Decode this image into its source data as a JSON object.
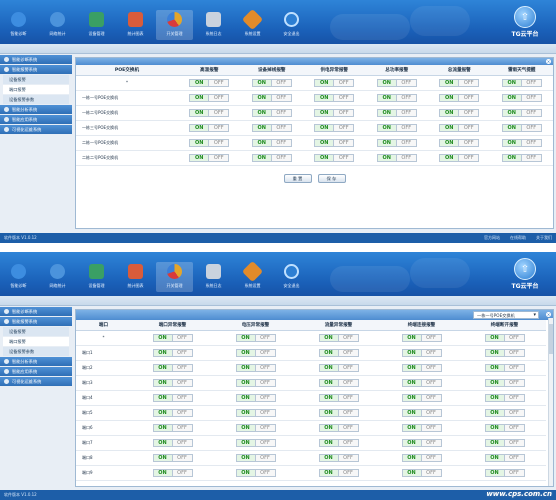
{
  "nav": {
    "items": [
      {
        "label": "智能诊断",
        "icon": "globe-icon",
        "color": "#3d8de0"
      },
      {
        "label": "网络统计",
        "icon": "globe-stats-icon",
        "color": "#4b93dc"
      },
      {
        "label": "设备管理",
        "icon": "device-icon",
        "color": "#3a9f64"
      },
      {
        "label": "统计图表",
        "icon": "chart-icon",
        "color": "#d95c3b"
      },
      {
        "label": "开关管理",
        "icon": "pie-icon",
        "color": "#e4a52a"
      },
      {
        "label": "系统日志",
        "icon": "log-icon",
        "color": "#c9d2de"
      },
      {
        "label": "系统设置",
        "icon": "tools-icon",
        "color": "#e28b2a"
      },
      {
        "label": "安全退出",
        "icon": "exit-icon",
        "color": "#2d7fd3"
      }
    ]
  },
  "brand": {
    "logo": "TG云平台",
    "arrow": "⇧"
  },
  "sidebar": {
    "sections": [
      {
        "label": "智能诊断系统"
      },
      {
        "label": "智能报警系统",
        "items": [
          "设备报警",
          "端口报警",
          "设备报警参数"
        ]
      },
      {
        "label": "智能分析系统"
      },
      {
        "label": "智能应用系统"
      },
      {
        "label": "可视化运维系统"
      }
    ]
  },
  "screen1": {
    "headers": [
      "POE交换机",
      "高温报警",
      "设备掉线报警",
      "供电异常报警",
      "总功率报警",
      "总流量报警",
      "雷雨天气提醒"
    ],
    "rows": [
      "*",
      "一栋一号POE交换机",
      "一栋二号POE交换机",
      "一栋三号POE交换机",
      "二栋一号POE交换机",
      "二栋二号POE交换机"
    ],
    "selected_side": "端口报警",
    "buttons": {
      "reset": "重 置",
      "save": "保 存"
    }
  },
  "screen2": {
    "headers": [
      "端口",
      "端口异常报警",
      "电压异常报警",
      "流量异常报警",
      "终端连接报警",
      "终端断开报警"
    ],
    "rows": [
      "*",
      "端口1",
      "端口2",
      "端口3",
      "端口4",
      "端口5",
      "端口6",
      "端口7",
      "端口8",
      "端口9"
    ],
    "selected_side": "端口报警",
    "select_value": "一栋一号POE交换机"
  },
  "toggle": {
    "on": "ON",
    "off": "OFF"
  },
  "footer": {
    "version": "软件版本 V1.0.12",
    "links": [
      "官方网站",
      "在线帮助",
      "关于我们"
    ]
  },
  "watermark": "www.cps.com.cn"
}
